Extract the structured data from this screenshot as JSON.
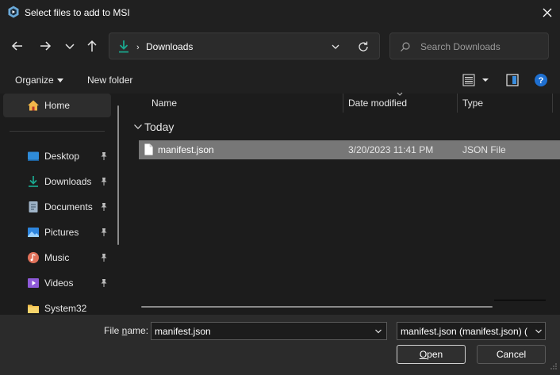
{
  "window": {
    "title": "Select files to add to MSI",
    "icons": {
      "app": "app-logo-icon",
      "close": "close-icon"
    }
  },
  "nav": {
    "icons": [
      "back-arrow-icon",
      "forward-arrow-icon",
      "recent-locations-chevron-icon",
      "up-arrow-icon"
    ],
    "address": {
      "location": "Downloads",
      "icon": "downloads-icon"
    },
    "search": {
      "placeholder": "Search Downloads"
    }
  },
  "command_bar": {
    "organize_label": "Organize",
    "new_folder_label": "New folder",
    "icons": [
      "details-view-icon",
      "view-options-chevron-icon",
      "preview-pane-icon",
      "help-icon"
    ]
  },
  "sidebar": {
    "home": {
      "label": "Home",
      "icon": "home-icon"
    },
    "items": [
      {
        "label": "Desktop",
        "icon": "desktop-icon",
        "pinned": true
      },
      {
        "label": "Downloads",
        "icon": "downloads-icon",
        "pinned": true
      },
      {
        "label": "Documents",
        "icon": "documents-icon",
        "pinned": true
      },
      {
        "label": "Pictures",
        "icon": "pictures-icon",
        "pinned": true
      },
      {
        "label": "Music",
        "icon": "music-icon",
        "pinned": true
      },
      {
        "label": "Videos",
        "icon": "videos-icon",
        "pinned": true
      },
      {
        "label": "System32",
        "icon": "folder-icon",
        "pinned": false
      }
    ]
  },
  "file_list": {
    "columns": [
      "Name",
      "Date modified",
      "Type"
    ],
    "groups": [
      {
        "label": "Today",
        "files": [
          {
            "name": "manifest.json",
            "date_modified": "3/20/2023 11:41 PM",
            "type": "JSON File",
            "selected": true
          }
        ]
      }
    ]
  },
  "footer": {
    "file_name_label_prefix": "File ",
    "file_name_label_accel": "n",
    "file_name_label_suffix": "ame:",
    "file_name_value": "manifest.json",
    "file_type_value": "manifest.json (manifest.json) (r",
    "open_label_accel": "O",
    "open_label_rest": "pen",
    "cancel_label": "Cancel"
  },
  "colors": {
    "background": "#1c1c1c",
    "chrome": "#202020",
    "footer": "#2b2b2b",
    "selection": "#777777",
    "accent_teal": "#1aa88f",
    "help_blue": "#1e6fd0"
  }
}
